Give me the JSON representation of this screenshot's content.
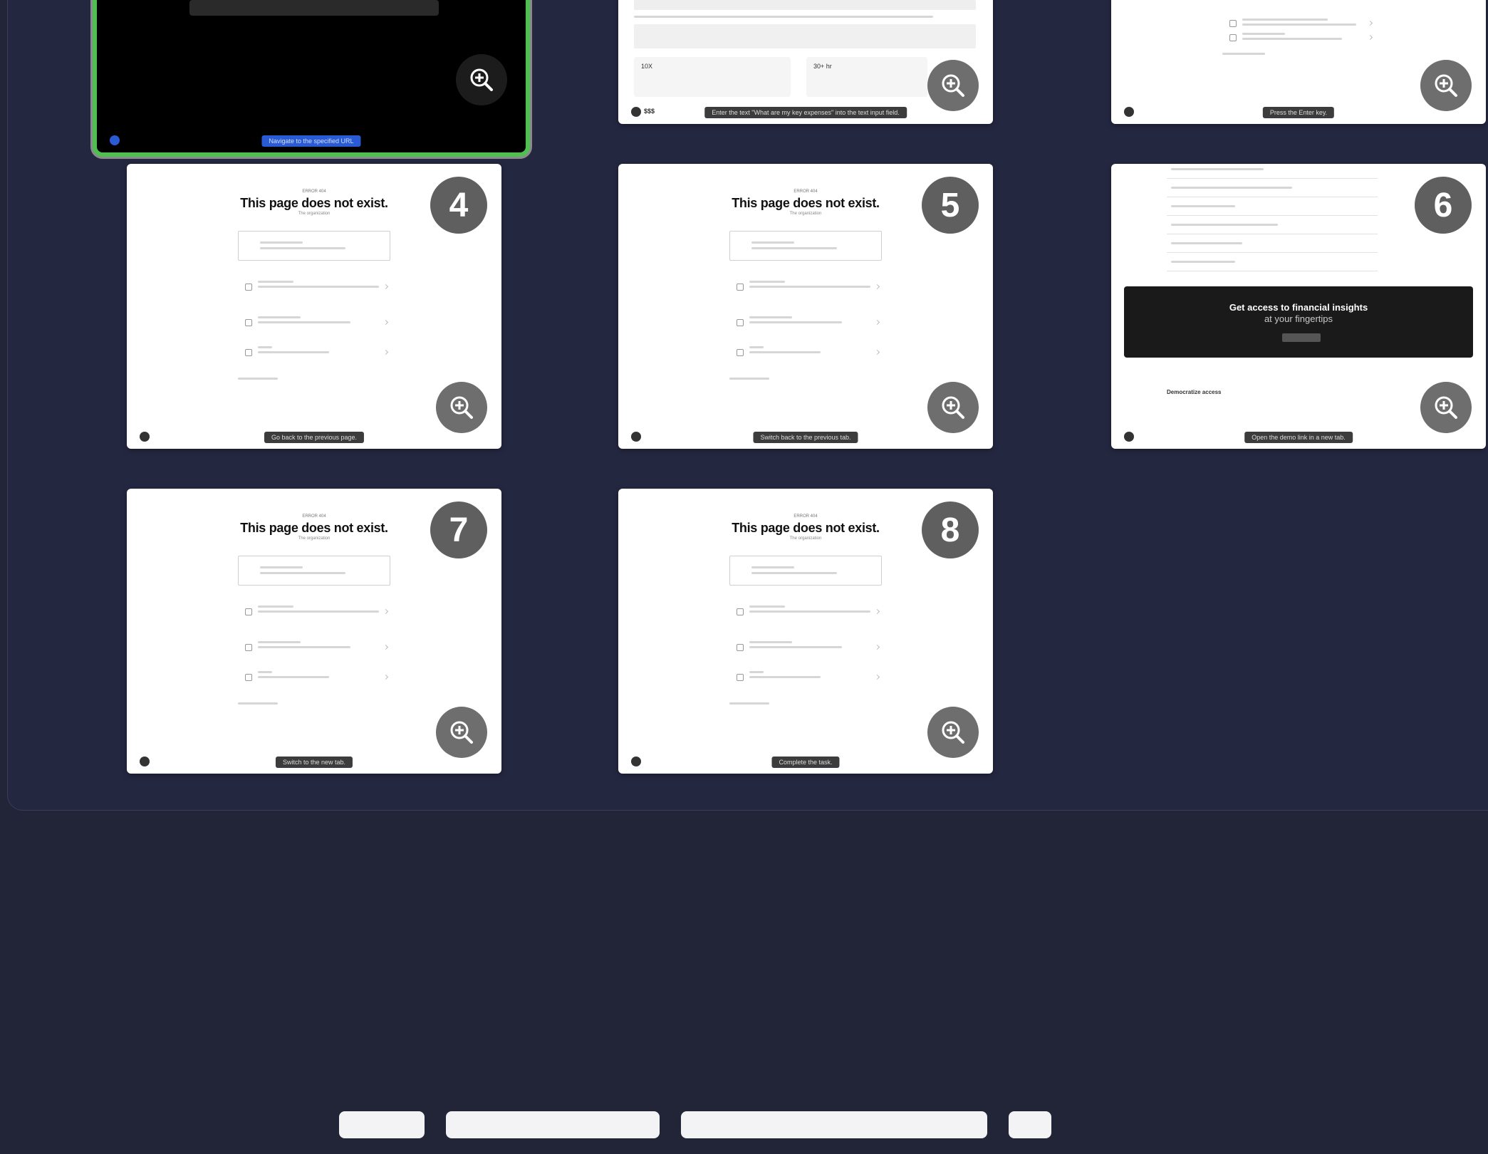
{
  "cards": [
    {
      "id": "1",
      "step": "",
      "caption": "Navigate to the specified URL",
      "variant": "dark"
    },
    {
      "id": "2",
      "step": "",
      "caption": "Enter the text \"What are my key expenses\" into the text input field.",
      "variant": "chat",
      "stat_a": "10X",
      "stat_b": "30+ hr",
      "price": "$$$"
    },
    {
      "id": "3",
      "step": "",
      "caption": "Press the Enter key.",
      "variant": "list"
    },
    {
      "id": "4",
      "step": "4",
      "caption": "Go back to the previous page.",
      "variant": "notfound"
    },
    {
      "id": "5",
      "step": "5",
      "caption": "Switch back to the previous tab.",
      "variant": "notfound"
    },
    {
      "id": "6",
      "step": "6",
      "caption": "Open the demo link in a new tab.",
      "variant": "landing",
      "banner_title": "Get access to financial insights",
      "banner_sub": "at your fingertips",
      "footer_title": "Democratize access"
    },
    {
      "id": "7",
      "step": "7",
      "caption": "Switch to the new tab.",
      "variant": "notfound"
    },
    {
      "id": "8",
      "step": "8",
      "caption": "Complete the task.",
      "variant": "notfound"
    }
  ],
  "notfound": {
    "eyebrow": "ERROR 404",
    "title": "This page does not exist.",
    "subtitle": "The organization"
  }
}
